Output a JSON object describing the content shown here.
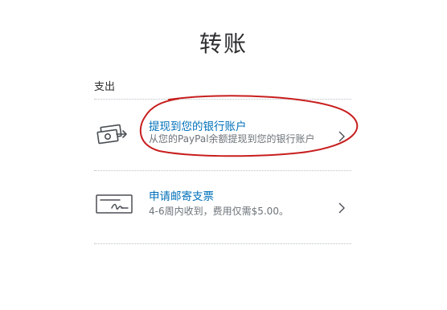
{
  "header": {
    "title": "转账"
  },
  "section": {
    "label": "支出"
  },
  "options": [
    {
      "title": "提现到您的银行账户",
      "subtitle": "从您的PayPal余额提现到您的银行账户",
      "icon": "cash-transfer-icon"
    },
    {
      "title": "申请邮寄支票",
      "subtitle": "4-6周内收到，费用仅需$5.00。",
      "icon": "check-icon"
    }
  ],
  "colors": {
    "link": "#0070ba",
    "text": "#2c2e2f",
    "muted": "#6c7378",
    "annotation": "#c81e1e"
  }
}
